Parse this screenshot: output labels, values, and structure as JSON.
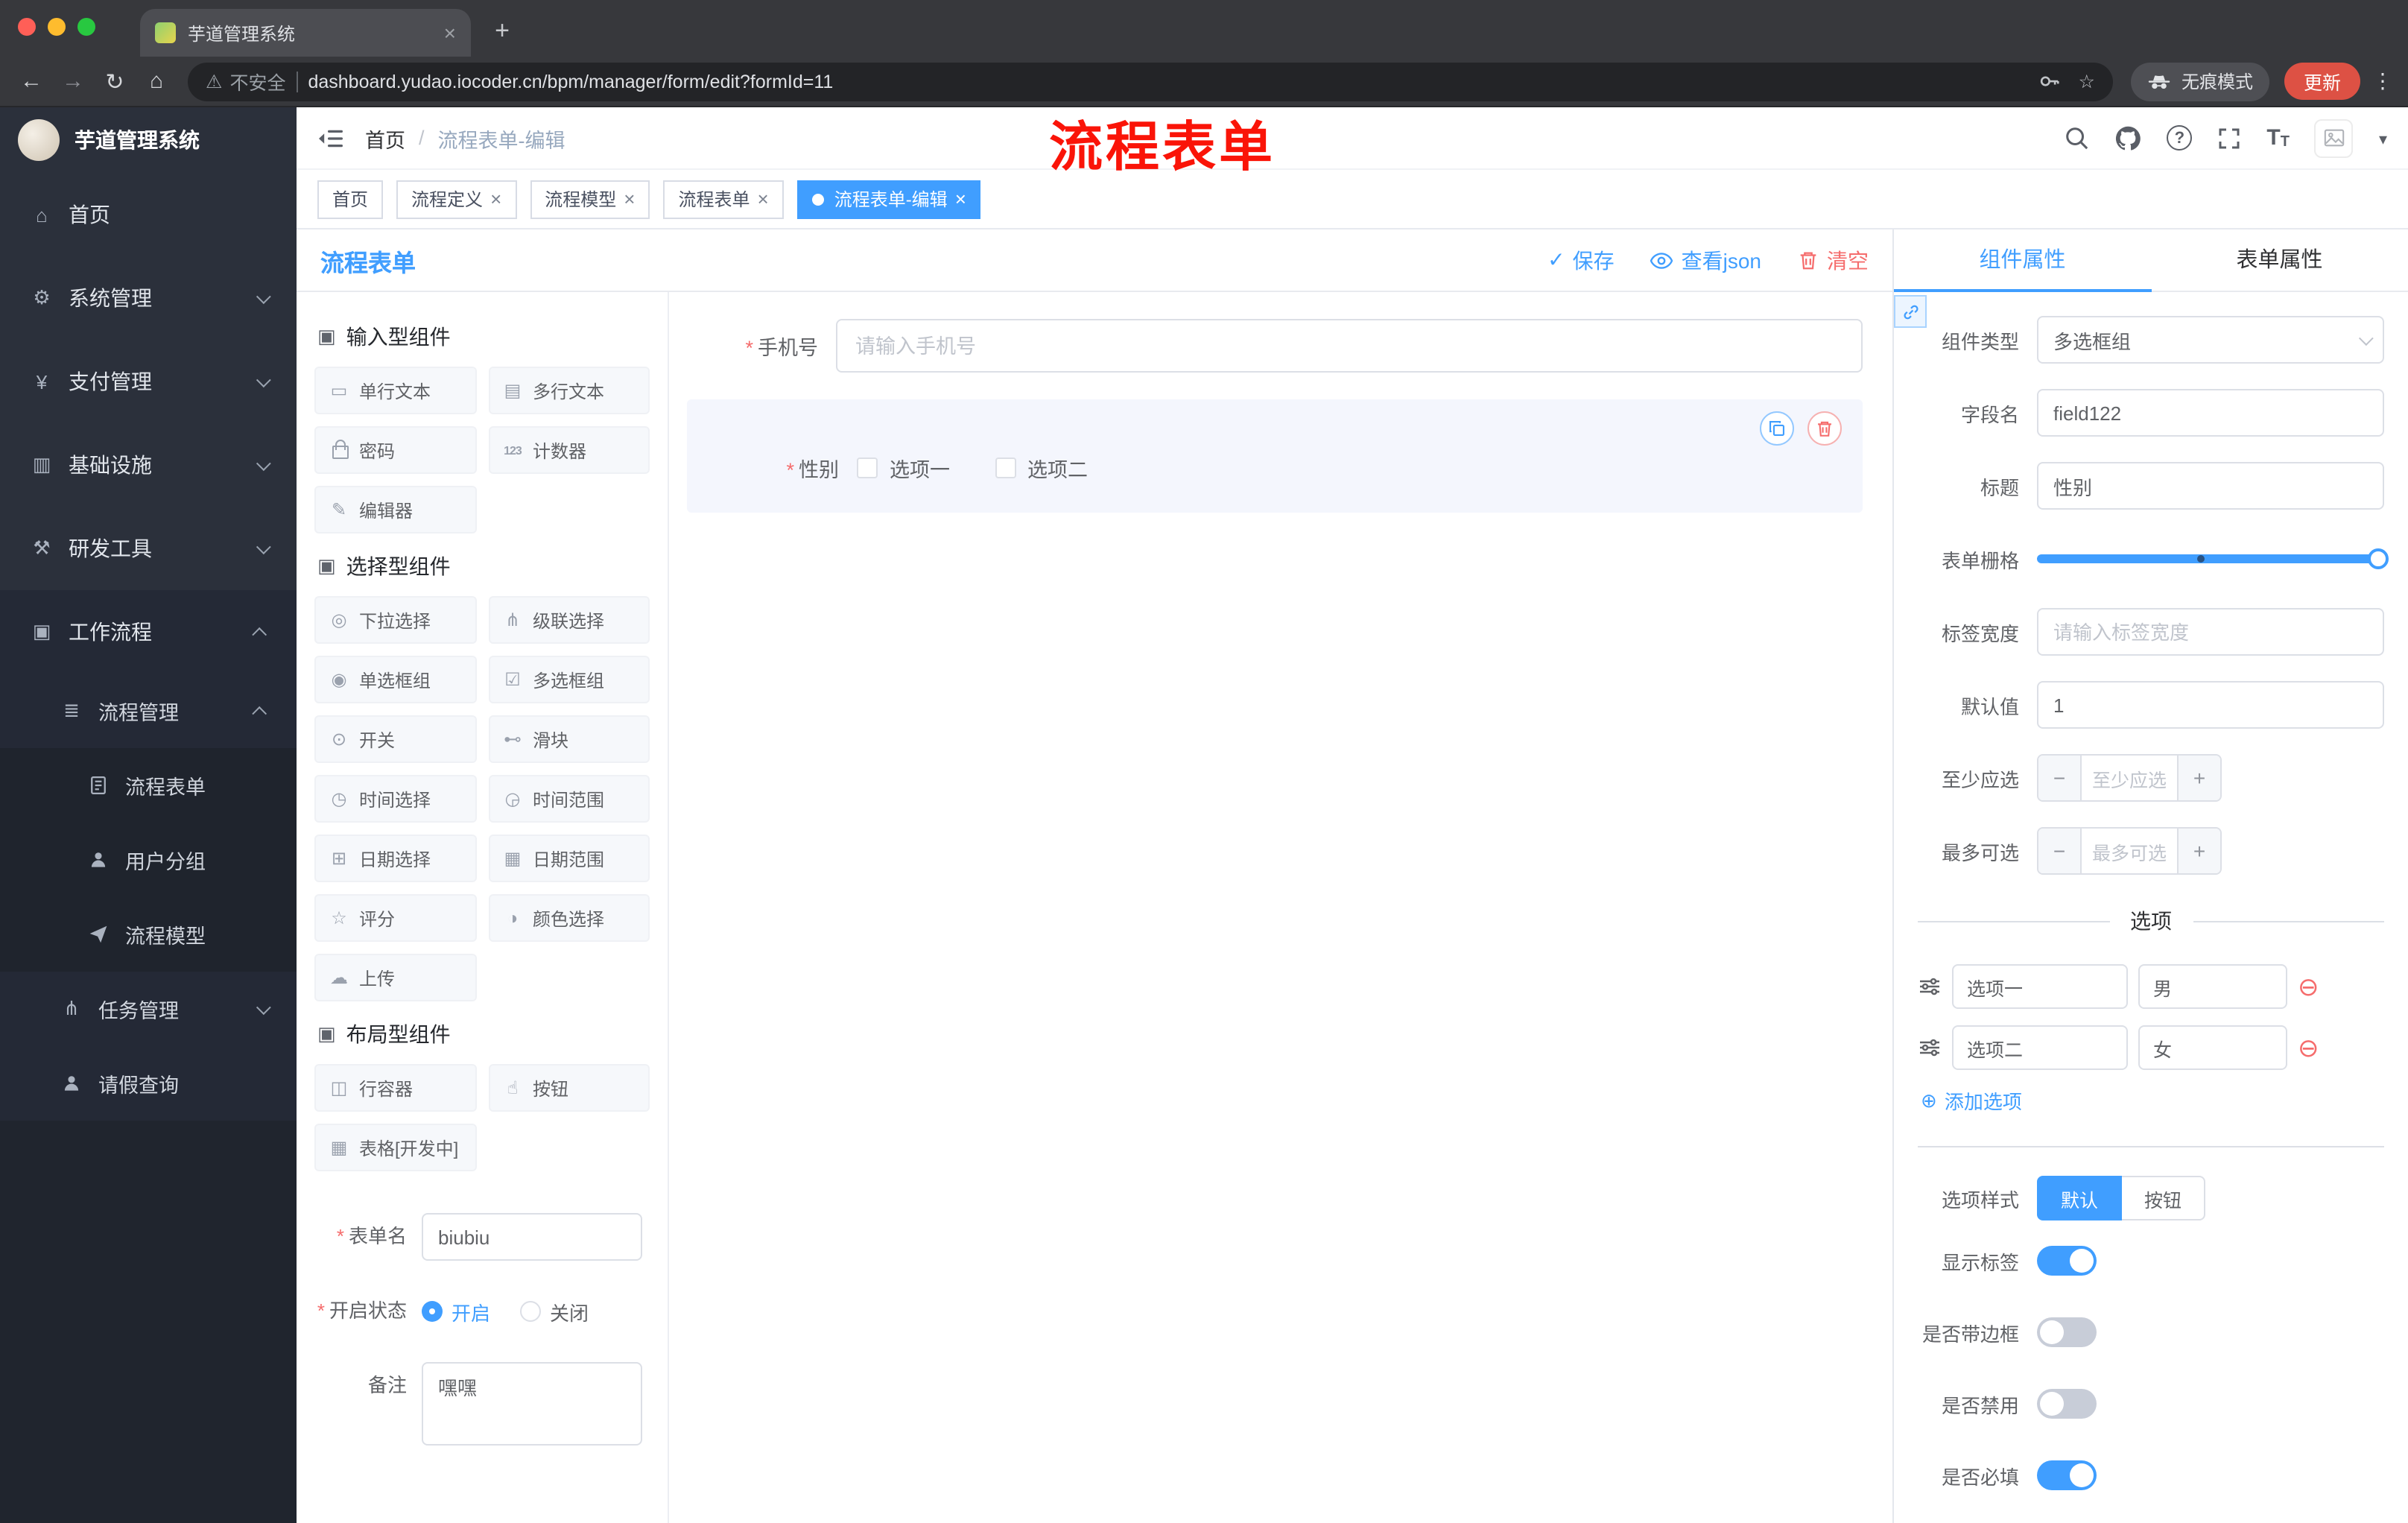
{
  "browser": {
    "tab_title": "芋道管理系统",
    "security_label": "不安全",
    "url": "dashboard.yudao.iocoder.cn/bpm/manager/form/edit?formId=11",
    "incognito_label": "无痕模式",
    "update_label": "更新"
  },
  "sidebar": {
    "logo_title": "芋道管理系统",
    "items": {
      "home": "首页",
      "system": "系统管理",
      "payment": "支付管理",
      "infra": "基础设施",
      "devtools": "研发工具",
      "workflow": "工作流程",
      "process_mgmt": "流程管理",
      "process_form": "流程表单",
      "user_group": "用户分组",
      "process_model": "流程模型",
      "task_mgmt": "任务管理",
      "leave_query": "请假查询"
    }
  },
  "header": {
    "breadcrumb_home": "首页",
    "breadcrumb_current": "流程表单-编辑",
    "annotation": "流程表单"
  },
  "tags": {
    "t1": "首页",
    "t2": "流程定义",
    "t3": "流程模型",
    "t4": "流程表单",
    "t5": "流程表单-编辑"
  },
  "editor": {
    "title": "流程表单",
    "save": "保存",
    "view_json": "查看json",
    "clear": "清空",
    "palette": {
      "input_section": "输入型组件",
      "select_section": "选择型组件",
      "layout_section": "布局型组件",
      "input_items": [
        "单行文本",
        "多行文本",
        "密码",
        "计数器",
        "编辑器"
      ],
      "select_items": [
        "下拉选择",
        "级联选择",
        "单选框组",
        "多选框组",
        "开关",
        "滑块",
        "时间选择",
        "时间范围",
        "日期选择",
        "日期范围",
        "评分",
        "颜色选择",
        "上传"
      ],
      "layout_items": [
        "行容器",
        "按钮",
        "表格[开发中]"
      ]
    },
    "meta": {
      "form_name_label": "表单名",
      "form_name_value": "biubiu",
      "status_label": "开启状态",
      "status_on": "开启",
      "status_off": "关闭",
      "status_selected": "开启",
      "remark_label": "备注",
      "remark_value": "嘿嘿"
    },
    "canvas": {
      "phone_label": "手机号",
      "phone_placeholder": "请输入手机号",
      "gender_label": "性别",
      "gender_option1": "选项一",
      "gender_option2": "选项二"
    }
  },
  "props": {
    "tab_component": "组件属性",
    "tab_form": "表单属性",
    "active_tab": "组件属性",
    "component_type_label": "组件类型",
    "component_type_value": "多选框组",
    "field_name_label": "字段名",
    "field_name_value": "field122",
    "title_label": "标题",
    "title_value": "性别",
    "grid_label": "表单栅格",
    "label_width_label": "标签宽度",
    "label_width_placeholder": "请输入标签宽度",
    "default_label": "默认值",
    "default_value": "1",
    "min_label": "至少应选",
    "min_placeholder": "至少应选",
    "max_label": "最多可选",
    "max_placeholder": "最多可选",
    "options_title": "选项",
    "option1_label": "选项一",
    "option1_value": "男",
    "option2_label": "选项二",
    "option2_value": "女",
    "add_option": "添加选项",
    "style_label": "选项样式",
    "style_default": "默认",
    "style_button": "按钮",
    "style_selected": "默认",
    "show_label": "显示标签",
    "border_label": "是否带边框",
    "disabled_label": "是否禁用",
    "required_label": "是否必填",
    "toggle_states": {
      "show_label": true,
      "border": false,
      "disabled": false,
      "required": true
    }
  },
  "colors": {
    "accent": "#409eff",
    "danger": "#f56c6c",
    "annotation_red": "#fa1408",
    "update_pill": "#dd5144"
  },
  "icons": [
    "search-icon",
    "github-icon",
    "help-icon",
    "fullscreen-icon",
    "font-size-icon",
    "avatar",
    "save-check-icon",
    "eye-icon",
    "trash-icon",
    "copy-icon",
    "link-icon",
    "drag-handle-icon",
    "incognito-icon",
    "key-icon",
    "bookmark-star-icon",
    "warning-icon"
  ]
}
